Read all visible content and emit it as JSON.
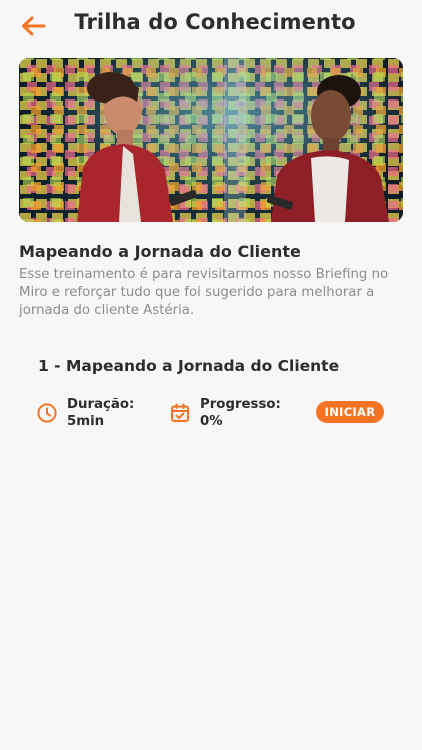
{
  "header": {
    "title": "Trilha do Conhecimento",
    "back_icon": "arrow-left-icon"
  },
  "banner": {
    "image": "two-women-viewing-sticky-note-wall"
  },
  "course": {
    "title": "Mapeando a Jornada do Cliente",
    "description": "Esse treinamento é para revisitarmos nosso Briefing no Miro e reforçar tudo que foi sugerido para melhorar a jornada do cliente Astéria."
  },
  "modules": [
    {
      "title": "1 - Mapeando a Jornada do Cliente",
      "duration_label": "Duração:",
      "duration_value": "5min",
      "duration_icon": "clock-icon",
      "progress_label": "Progresso:",
      "progress_value": "0%",
      "progress_icon": "calendar-check-icon",
      "button_label": "INICIAR"
    }
  ],
  "colors": {
    "accent": "#f47424",
    "background": "#f7f7f7",
    "text": "#2d2d2d",
    "muted": "#8c8c8c"
  }
}
